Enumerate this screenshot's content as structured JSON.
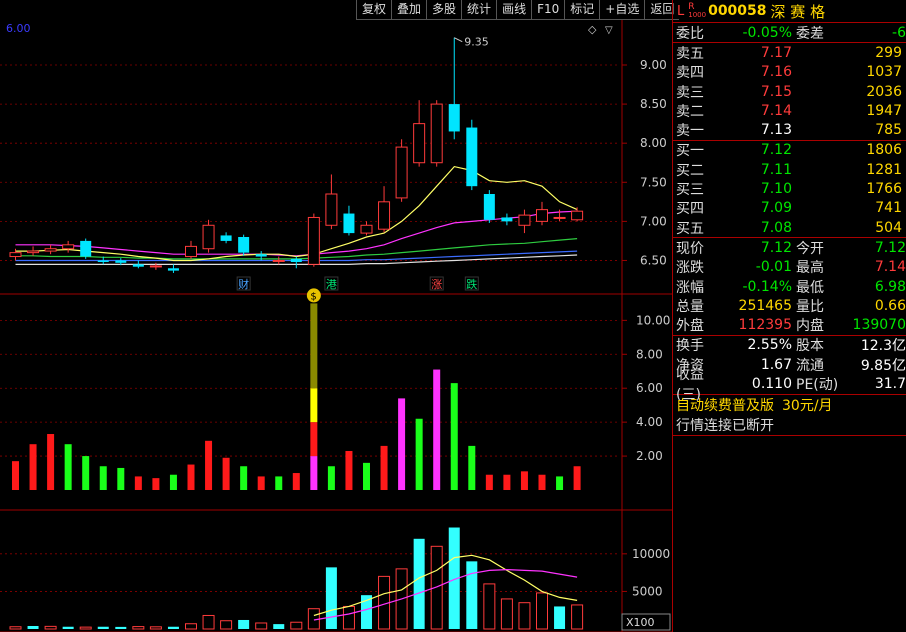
{
  "toolbar": [
    "复权",
    "叠加",
    "多股",
    "统计",
    "画线",
    "F10",
    "标记",
    "+自选",
    "返回"
  ],
  "price_axis": {
    "top_label": "6.00",
    "ticks": [
      {
        "v": 9.0,
        "t": "9.00"
      },
      {
        "v": 8.5,
        "t": "8.50"
      },
      {
        "v": 8.0,
        "t": "8.00"
      },
      {
        "v": 7.5,
        "t": "7.50"
      },
      {
        "v": 7.0,
        "t": "7.00"
      },
      {
        "v": 6.5,
        "t": "6.50"
      }
    ],
    "max_label": "9.35"
  },
  "event_markers": [
    {
      "i": 13,
      "text": "财",
      "color": "#4aa3ff"
    },
    {
      "i": 18,
      "text": "港",
      "color": "#00e676"
    },
    {
      "i": 24,
      "text": "涨",
      "color": "#ff4444"
    },
    {
      "i": 26,
      "text": "跌",
      "color": "#00e676"
    }
  ],
  "mid_axis": {
    "ticks": [
      {
        "v": 10,
        "t": "10.00"
      },
      {
        "v": 8,
        "t": "8.00"
      },
      {
        "v": 6,
        "t": "6.00"
      },
      {
        "v": 4,
        "t": "4.00"
      },
      {
        "v": 2,
        "t": "2.00"
      }
    ]
  },
  "vol_axis": {
    "ticks": [
      {
        "v": 10000,
        "t": "10000"
      },
      {
        "v": 5000,
        "t": "5000"
      }
    ],
    "unit": "X100"
  },
  "chart_data": {
    "type": "candlestick",
    "candles": [
      {
        "o": 6.55,
        "c": 6.6,
        "h": 6.65,
        "l": 6.5
      },
      {
        "o": 6.6,
        "c": 6.62,
        "h": 6.68,
        "l": 6.56
      },
      {
        "o": 6.62,
        "c": 6.65,
        "h": 6.7,
        "l": 6.58
      },
      {
        "o": 6.65,
        "c": 6.7,
        "h": 6.75,
        "l": 6.6
      },
      {
        "o": 6.75,
        "c": 6.55,
        "h": 6.78,
        "l": 6.52
      },
      {
        "o": 6.5,
        "c": 6.48,
        "h": 6.55,
        "l": 6.45
      },
      {
        "o": 6.5,
        "c": 6.47,
        "h": 6.53,
        "l": 6.44
      },
      {
        "o": 6.45,
        "c": 6.42,
        "h": 6.5,
        "l": 6.4
      },
      {
        "o": 6.42,
        "c": 6.43,
        "h": 6.47,
        "l": 6.38
      },
      {
        "o": 6.4,
        "c": 6.37,
        "h": 6.45,
        "l": 6.34
      },
      {
        "o": 6.55,
        "c": 6.68,
        "h": 6.75,
        "l": 6.52
      },
      {
        "o": 6.65,
        "c": 6.95,
        "h": 7.02,
        "l": 6.6
      },
      {
        "o": 6.82,
        "c": 6.75,
        "h": 6.86,
        "l": 6.72
      },
      {
        "o": 6.8,
        "c": 6.6,
        "h": 6.83,
        "l": 6.56
      },
      {
        "o": 6.58,
        "c": 6.55,
        "h": 6.62,
        "l": 6.5
      },
      {
        "o": 6.5,
        "c": 6.5,
        "h": 6.55,
        "l": 6.45
      },
      {
        "o": 6.52,
        "c": 6.48,
        "h": 6.55,
        "l": 6.4
      },
      {
        "o": 6.45,
        "c": 7.05,
        "h": 7.1,
        "l": 6.42
      },
      {
        "o": 6.95,
        "c": 7.35,
        "h": 7.6,
        "l": 6.9
      },
      {
        "o": 7.1,
        "c": 6.85,
        "h": 7.2,
        "l": 6.82
      },
      {
        "o": 6.85,
        "c": 6.95,
        "h": 7.0,
        "l": 6.82
      },
      {
        "o": 6.9,
        "c": 7.25,
        "h": 7.45,
        "l": 6.86
      },
      {
        "o": 7.3,
        "c": 7.95,
        "h": 8.05,
        "l": 7.25
      },
      {
        "o": 7.75,
        "c": 8.25,
        "h": 8.55,
        "l": 7.7
      },
      {
        "o": 7.75,
        "c": 8.5,
        "h": 8.55,
        "l": 7.7
      },
      {
        "o": 8.5,
        "c": 8.15,
        "h": 9.35,
        "l": 8.05
      },
      {
        "o": 8.2,
        "c": 7.45,
        "h": 8.3,
        "l": 7.4
      },
      {
        "o": 7.35,
        "c": 7.02,
        "h": 7.4,
        "l": 6.98
      },
      {
        "o": 7.05,
        "c": 7.0,
        "h": 7.1,
        "l": 6.95
      },
      {
        "o": 6.95,
        "c": 7.08,
        "h": 7.15,
        "l": 6.85
      },
      {
        "o": 7.0,
        "c": 7.15,
        "h": 7.25,
        "l": 6.95
      },
      {
        "o": 7.05,
        "c": 7.05,
        "h": 7.15,
        "l": 7.0
      },
      {
        "o": 7.02,
        "c": 7.13,
        "h": 7.18,
        "l": 7.0
      }
    ],
    "ma_yellow": [
      6.62,
      6.62,
      6.63,
      6.64,
      6.62,
      6.6,
      6.58,
      6.55,
      6.53,
      6.5,
      6.5,
      6.52,
      6.55,
      6.57,
      6.58,
      6.58,
      6.55,
      6.58,
      6.65,
      6.72,
      6.8,
      6.85,
      7.0,
      7.2,
      7.45,
      7.7,
      7.65,
      7.52,
      7.5,
      7.52,
      7.45,
      7.25,
      7.15
    ],
    "ma_magenta": [
      6.7,
      6.7,
      6.7,
      6.69,
      6.68,
      6.66,
      6.64,
      6.62,
      6.6,
      6.58,
      6.58,
      6.58,
      6.58,
      6.58,
      6.58,
      6.57,
      6.56,
      6.58,
      6.6,
      6.62,
      6.65,
      6.7,
      6.78,
      6.85,
      6.92,
      6.98,
      7.0,
      7.02,
      7.04,
      7.06,
      7.1,
      7.12,
      7.13
    ],
    "ma_green": [
      6.56,
      6.56,
      6.55,
      6.55,
      6.55,
      6.54,
      6.54,
      6.53,
      6.53,
      6.52,
      6.52,
      6.52,
      6.52,
      6.52,
      6.52,
      6.52,
      6.52,
      6.53,
      6.54,
      6.55,
      6.57,
      6.58,
      6.6,
      6.62,
      6.64,
      6.66,
      6.68,
      6.7,
      6.71,
      6.72,
      6.74,
      6.76,
      6.78
    ],
    "ma_blue": [
      6.5,
      6.5,
      6.5,
      6.5,
      6.5,
      6.5,
      6.5,
      6.5,
      6.5,
      6.5,
      6.5,
      6.5,
      6.5,
      6.5,
      6.5,
      6.5,
      6.5,
      6.5,
      6.5,
      6.5,
      6.51,
      6.51,
      6.52,
      6.53,
      6.54,
      6.55,
      6.56,
      6.57,
      6.58,
      6.59,
      6.6,
      6.61,
      6.62
    ],
    "ma_white": [
      6.45,
      6.45,
      6.45,
      6.45,
      6.45,
      6.45,
      6.45,
      6.45,
      6.45,
      6.45,
      6.45,
      6.45,
      6.45,
      6.45,
      6.45,
      6.45,
      6.45,
      6.45,
      6.45,
      6.45,
      6.46,
      6.46,
      6.47,
      6.48,
      6.49,
      6.5,
      6.51,
      6.52,
      6.53,
      6.54,
      6.55,
      6.56,
      6.57
    ],
    "turnover": [
      1.7,
      2.7,
      3.3,
      2.7,
      2.0,
      1.4,
      1.3,
      0.8,
      0.7,
      0.9,
      1.5,
      2.9,
      1.9,
      1.4,
      0.8,
      0.8,
      1.0,
      11.0,
      1.4,
      2.3,
      1.6,
      2.6,
      5.4,
      4.2,
      7.1,
      6.3,
      2.6,
      0.9,
      0.9,
      1.1,
      0.9,
      0.8,
      1.4
    ],
    "turnover_colors": [
      "red",
      "red",
      "red",
      "green",
      "green",
      "green",
      "green",
      "red",
      "red",
      "green",
      "red",
      "red",
      "red",
      "green",
      "red",
      "green",
      "red",
      "stack",
      "green",
      "red",
      "green",
      "red",
      "magenta",
      "green",
      "magenta",
      "green",
      "green",
      "red",
      "red",
      "red",
      "red",
      "green",
      "red"
    ],
    "volume": [
      300,
      400,
      350,
      300,
      250,
      300,
      280,
      320,
      290,
      300,
      700,
      1800,
      1100,
      1200,
      800,
      650,
      900,
      2700,
      8200,
      3000,
      4500,
      7000,
      8000,
      12000,
      11000,
      13500,
      9000,
      6000,
      4000,
      3500,
      4800,
      3000,
      3200
    ],
    "volume_colors": [
      "red",
      "cyan",
      "red",
      "cyan",
      "red",
      "cyan",
      "cyan",
      "red",
      "red",
      "cyan",
      "red",
      "red",
      "red",
      "cyan",
      "red",
      "cyan",
      "red",
      "red",
      "cyan",
      "red",
      "cyan",
      "red",
      "red",
      "cyan",
      "red",
      "cyan",
      "cyan",
      "red",
      "red",
      "red",
      "red",
      "cyan",
      "red"
    ],
    "vol_ma_yellow": [
      null,
      null,
      null,
      null,
      null,
      null,
      null,
      null,
      null,
      null,
      null,
      null,
      null,
      null,
      null,
      null,
      null,
      1800,
      2500,
      3000,
      3800,
      4700,
      5200,
      6800,
      7800,
      9500,
      9800,
      9200,
      7800,
      6500,
      5000,
      4200,
      3800
    ],
    "vol_ma_magenta": [
      null,
      null,
      null,
      null,
      null,
      null,
      null,
      null,
      null,
      null,
      null,
      null,
      null,
      null,
      null,
      null,
      null,
      1200,
      1600,
      2000,
      2600,
      3300,
      4000,
      4800,
      5600,
      6600,
      7400,
      7800,
      7900,
      7800,
      7700,
      7300,
      6900
    ]
  },
  "quote": {
    "code": "000058",
    "name": "深 赛 格",
    "r_label": "R",
    "l_label": "L",
    "sub_label": "1000",
    "weibi_lbl": "委比",
    "weibi": "-0.05%",
    "weicha_lbl": "委差",
    "weicha": "-6",
    "asks": [
      {
        "lbl": "卖五",
        "price": "7.17",
        "vol": "299"
      },
      {
        "lbl": "卖四",
        "price": "7.16",
        "vol": "1037"
      },
      {
        "lbl": "卖三",
        "price": "7.15",
        "vol": "2036"
      },
      {
        "lbl": "卖二",
        "price": "7.14",
        "vol": "1947"
      },
      {
        "lbl": "卖一",
        "price": "7.13",
        "vol": "785"
      }
    ],
    "bids": [
      {
        "lbl": "买一",
        "price": "7.12",
        "vol": "1806"
      },
      {
        "lbl": "买二",
        "price": "7.11",
        "vol": "1281"
      },
      {
        "lbl": "买三",
        "price": "7.10",
        "vol": "1766"
      },
      {
        "lbl": "买四",
        "price": "7.09",
        "vol": "741"
      },
      {
        "lbl": "买五",
        "price": "7.08",
        "vol": "504"
      }
    ],
    "stats": [
      {
        "l1": "现价",
        "v1": "7.12",
        "c1": "green",
        "l2": "今开",
        "v2": "7.12",
        "c2": "green"
      },
      {
        "l1": "涨跌",
        "v1": "-0.01",
        "c1": "green",
        "l2": "最高",
        "v2": "7.14",
        "c2": "red"
      },
      {
        "l1": "涨幅",
        "v1": "-0.14%",
        "c1": "green",
        "l2": "最低",
        "v2": "6.98",
        "c2": "green"
      },
      {
        "l1": "总量",
        "v1": "251465",
        "c1": "yellow",
        "l2": "量比",
        "v2": "0.66",
        "c2": "yellow"
      },
      {
        "l1": "外盘",
        "v1": "112395",
        "c1": "red",
        "l2": "内盘",
        "v2": "139070",
        "c2": "green"
      }
    ],
    "stats2": [
      {
        "l1": "换手",
        "v1": "2.55%",
        "l2": "股本",
        "v2": "12.3亿"
      },
      {
        "l1": "净资",
        "v1": "1.67",
        "l2": "流通",
        "v2": "9.85亿"
      },
      {
        "l1": "收益(三)",
        "v1": "0.110",
        "l2": "PE(动)",
        "v2": "31.7"
      }
    ],
    "promo": "自动续费普及版",
    "promo_price": "30元/月",
    "conn": "行情连接已断开"
  },
  "colors": {
    "up": "#ff3b3b",
    "down": "#00e5ff",
    "grid": "#8b0000",
    "panel_border": "#a00000"
  }
}
